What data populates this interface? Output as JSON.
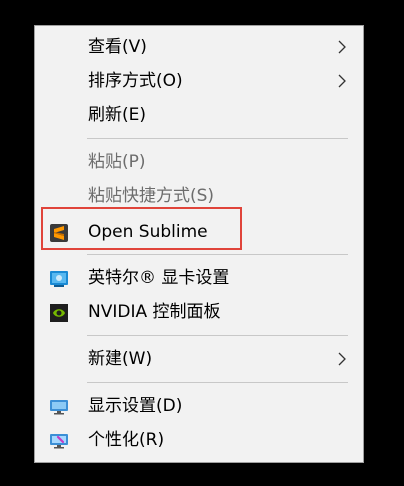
{
  "menu": {
    "items": [
      {
        "id": "view",
        "label": "查看(V)",
        "has_submenu": true
      },
      {
        "id": "sort",
        "label": "排序方式(O)",
        "has_submenu": true
      },
      {
        "id": "refresh",
        "label": "刷新(E)"
      },
      {
        "id": "paste",
        "label": "粘贴(P)",
        "disabled": true
      },
      {
        "id": "paste_shortcut",
        "label": "粘贴快捷方式(S)",
        "disabled": true
      },
      {
        "id": "open_sublime",
        "label": "Open Sublime",
        "icon": "sublime-text-icon"
      },
      {
        "id": "intel_graphics",
        "label": "英特尔® 显卡设置",
        "icon": "intel-graphics-icon"
      },
      {
        "id": "nvidia_panel",
        "label": "NVIDIA 控制面板",
        "icon": "nvidia-icon"
      },
      {
        "id": "new",
        "label": "新建(W)",
        "has_submenu": true
      },
      {
        "id": "display",
        "label": "显示设置(D)",
        "icon": "display-monitor-icon"
      },
      {
        "id": "personalize",
        "label": "个性化(R)",
        "icon": "personalize-monitor-icon"
      }
    ]
  },
  "colors": {
    "menu_bg": "#f2f2f2",
    "separator": "#c8c8c8",
    "disabled_text": "#6d6d6d",
    "highlight_box": "#e0443a",
    "sublime_orange": "#ff9800",
    "nvidia_green": "#76b900"
  }
}
